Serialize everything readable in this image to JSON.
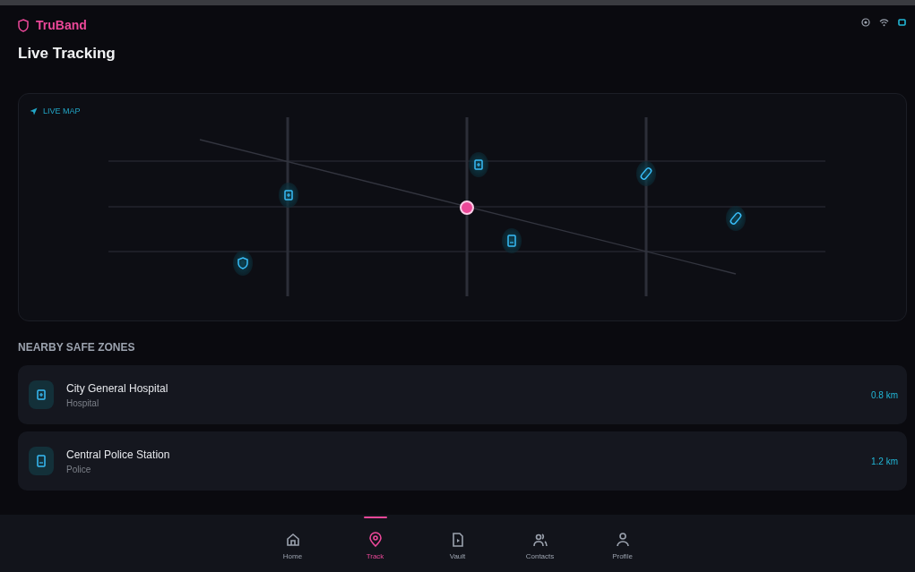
{
  "app": {
    "brand": "TruBand",
    "title": "Live Tracking"
  },
  "map": {
    "label": "LIVE MAP",
    "markers": [
      {
        "kind": "shield"
      },
      {
        "kind": "hospital"
      },
      {
        "kind": "hospital"
      },
      {
        "kind": "police"
      },
      {
        "kind": "pharmacy"
      },
      {
        "kind": "pharmacy"
      }
    ]
  },
  "safe_zones": {
    "title": "NEARBY SAFE ZONES",
    "items": [
      {
        "kind": "hospital",
        "name": "City General Hospital",
        "type": "Hospital",
        "distance": "0.8 km"
      },
      {
        "kind": "police",
        "name": "Central Police Station",
        "type": "Police",
        "distance": "1.2 km"
      }
    ]
  },
  "nav": [
    {
      "label": "Home",
      "kind": "home",
      "selected": false
    },
    {
      "label": "Track",
      "kind": "pin",
      "selected": true
    },
    {
      "label": "Vault",
      "kind": "file",
      "selected": false
    },
    {
      "label": "Contacts",
      "kind": "people",
      "selected": false
    },
    {
      "label": "Profile",
      "kind": "person",
      "selected": false
    }
  ]
}
